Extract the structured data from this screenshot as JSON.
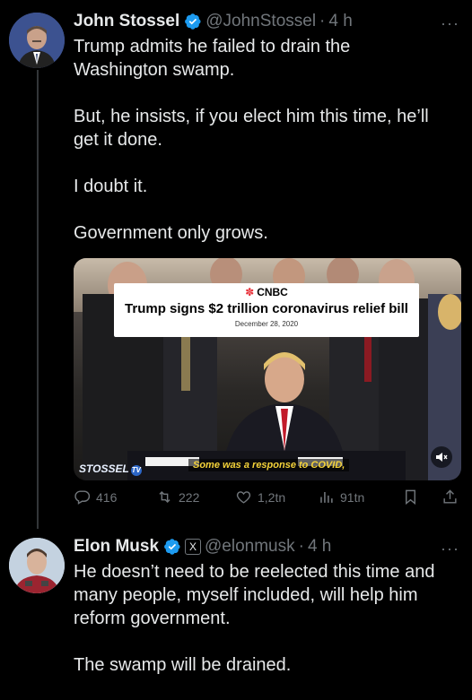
{
  "tweet1": {
    "name": "John Stossel",
    "handle": "@JohnStossel",
    "separator": "·",
    "time": "4 h",
    "more": "···",
    "paragraphs": [
      [
        "Trump admits he failed to drain the",
        "Washington swamp."
      ],
      [
        "But, he insists, if you elect him this time, he’ll",
        "get it done."
      ],
      [
        "I doubt it."
      ],
      [
        "Government only grows."
      ]
    ],
    "media": {
      "network": "CNBC",
      "headline": "Trump signs $2 trillion coronavirus relief bill",
      "date": "December 28, 2020",
      "subtitle": "Some was a response to COVID,",
      "watermark": "STOSSEL",
      "watermark_badge": "TV",
      "mute_icon": "speaker-muted-icon"
    },
    "actions": {
      "replies": "416",
      "reposts": "222",
      "likes": "1,2tn",
      "views": "91tn"
    }
  },
  "tweet2": {
    "name": "Elon Musk",
    "handle": "@elonmusk",
    "separator": "·",
    "time": "4 h",
    "more": "···",
    "affiliate_badge": "X",
    "paragraphs": [
      [
        "He doesn’t need to be reelected this time and",
        "many people, myself included, will help him",
        "reform government."
      ],
      [
        "The swamp will be drained."
      ]
    ]
  },
  "colors": {
    "background": "#000000",
    "text": "#e7e9ea",
    "muted": "#71767b",
    "verified": "#1d9bf0"
  }
}
